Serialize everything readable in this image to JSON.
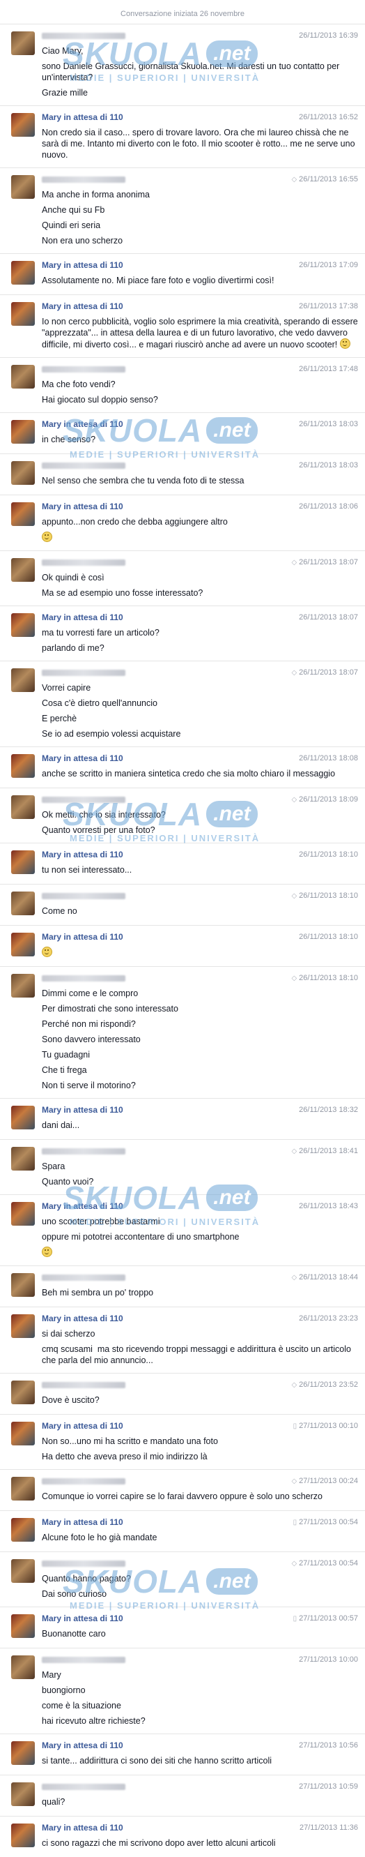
{
  "conversation": {
    "start_label": "Conversazione iniziata 26 novembre"
  },
  "watermark": {
    "logo": "SKUOLA",
    "suffix": ".net",
    "tagline": "MEDIE | SUPERIORI | UNIVERSITÀ"
  },
  "messages": [
    {
      "sender": "",
      "mary": false,
      "time": "26/11/2013 16:39",
      "icon": "",
      "lines": [
        "Ciao Mary,",
        "sono Daniele Grassucci, giornalista Skuola.net. Mi daresti un tuo contatto per un'intervista?",
        "Grazie mille"
      ]
    },
    {
      "sender": "Mary in attesa di 110",
      "mary": true,
      "time": "26/11/2013 16:52",
      "icon": "",
      "lines": [
        "Non credo sia il caso... spero di trovare lavoro. Ora che mi laureo chissà che ne sarà di me. Intanto mi diverto con le foto. Il mio scooter è rotto... me ne serve uno nuovo."
      ]
    },
    {
      "sender": "",
      "mary": false,
      "time": "26/11/2013 16:55",
      "icon": "location-icon",
      "lines": [
        "Ma anche in forma anonima",
        "Anche qui su Fb",
        "Quindi eri seria",
        "Non era uno scherzo"
      ]
    },
    {
      "sender": "Mary in attesa di 110",
      "mary": true,
      "time": "26/11/2013 17:09",
      "icon": "",
      "lines": [
        "Assolutamente no. Mi piace fare foto e voglio divertirmi così!"
      ]
    },
    {
      "sender": "Mary in attesa di 110",
      "mary": true,
      "time": "26/11/2013 17:38",
      "icon": "",
      "lines": [
        "Io non cerco pubblicità, voglio solo esprimere la mia creatività, sperando di essere \"apprezzata\"... in attesa della laurea e di un futuro lavorativo, che vedo davvero difficile, mi diverto così... e magari riuscirò anche ad avere un nuovo scooter! :)"
      ]
    },
    {
      "sender": "",
      "mary": false,
      "time": "26/11/2013 17:48",
      "icon": "",
      "lines": [
        "Ma che foto vendi?",
        "Hai giocato sul doppio senso?"
      ]
    },
    {
      "sender": "Mary in attesa di 110",
      "mary": true,
      "time": "26/11/2013 18:03",
      "icon": "",
      "lines": [
        "in che senso?"
      ]
    },
    {
      "sender": "",
      "mary": false,
      "time": "26/11/2013 18:03",
      "icon": "",
      "lines": [
        "Nel senso che sembra che tu venda foto di te stessa"
      ]
    },
    {
      "sender": "Mary in attesa di 110",
      "mary": true,
      "time": "26/11/2013 18:06",
      "icon": "",
      "lines": [
        "appunto...non credo che debba aggiungere altro",
        ":)"
      ]
    },
    {
      "sender": "",
      "mary": false,
      "time": "26/11/2013 18:07",
      "icon": "location-icon",
      "lines": [
        "Ok quindi è così",
        "Ma se ad esempio uno fosse interessato?"
      ]
    },
    {
      "sender": "Mary in attesa di 110",
      "mary": true,
      "time": "26/11/2013 18:07",
      "icon": "",
      "lines": [
        "ma tu vorresti fare un articolo?",
        "parlando di me?"
      ]
    },
    {
      "sender": "",
      "mary": false,
      "time": "26/11/2013 18:07",
      "icon": "location-icon",
      "lines": [
        "Vorrei capire",
        "Cosa c'è dietro quell'annuncio",
        "E perchè",
        "Se io ad esempio volessi acquistare"
      ]
    },
    {
      "sender": "Mary in attesa di 110",
      "mary": true,
      "time": "26/11/2013 18:08",
      "icon": "",
      "lines": [
        "anche se scritto in maniera sintetica credo che sia molto chiaro il messaggio"
      ]
    },
    {
      "sender": "",
      "mary": false,
      "time": "26/11/2013 18:09",
      "icon": "location-icon",
      "lines": [
        "Ok metti. che io sia interessato?",
        "Quanto vorresti per una foto?"
      ]
    },
    {
      "sender": "Mary in attesa di 110",
      "mary": true,
      "time": "26/11/2013 18:10",
      "icon": "",
      "lines": [
        "tu non sei interessato..."
      ]
    },
    {
      "sender": "",
      "mary": false,
      "time": "26/11/2013 18:10",
      "icon": "location-icon",
      "lines": [
        "Come no"
      ]
    },
    {
      "sender": "Mary in attesa di 110",
      "mary": true,
      "time": "26/11/2013 18:10",
      "icon": "",
      "lines": [
        ":)"
      ]
    },
    {
      "sender": "",
      "mary": false,
      "time": "26/11/2013 18:10",
      "icon": "location-icon",
      "lines": [
        "Dimmi come e le compro",
        "Per dimostrati che sono interessato",
        "Perché non mi rispondi?",
        "Sono davvero interessato",
        "Tu guadagni",
        "Che ti frega",
        "Non ti serve il motorino?"
      ]
    },
    {
      "sender": "Mary in attesa di 110",
      "mary": true,
      "time": "26/11/2013 18:32",
      "icon": "",
      "lines": [
        "dani dai..."
      ]
    },
    {
      "sender": "",
      "mary": false,
      "time": "26/11/2013 18:41",
      "icon": "location-icon",
      "lines": [
        "Spara",
        "Quanto vuoi?"
      ]
    },
    {
      "sender": "Mary in attesa di 110",
      "mary": true,
      "time": "26/11/2013 18:43",
      "icon": "",
      "lines": [
        "uno scooter potrebbe bastarmi",
        "oppure mi pototrei accontentare di uno smartphone",
        ":)"
      ]
    },
    {
      "sender": "",
      "mary": false,
      "time": "26/11/2013 18:44",
      "icon": "location-icon",
      "lines": [
        "Beh mi sembra un po' troppo"
      ]
    },
    {
      "sender": "Mary in attesa di 110",
      "mary": true,
      "time": "26/11/2013 23:23",
      "icon": "",
      "lines": [
        "si dai scherzo",
        "cmq scusami  ma sto ricevendo troppi messaggi e addirittura è uscito un articolo che parla del mio annuncio..."
      ]
    },
    {
      "sender": "",
      "mary": false,
      "time": "26/11/2013 23:52",
      "icon": "location-icon",
      "lines": [
        "Dove è uscito?"
      ]
    },
    {
      "sender": "Mary in attesa di 110",
      "mary": true,
      "time": "27/11/2013 00:10",
      "icon": "phone-icon",
      "lines": [
        "Non so...uno mi ha scritto e mandato una foto",
        "Ha detto che aveva preso il mio indirizzo là"
      ]
    },
    {
      "sender": "",
      "mary": false,
      "time": "27/11/2013 00:24",
      "icon": "location-icon",
      "lines": [
        "Comunque io vorrei capire se lo farai davvero oppure è solo uno scherzo"
      ]
    },
    {
      "sender": "Mary in attesa di 110",
      "mary": true,
      "time": "27/11/2013 00:54",
      "icon": "phone-icon",
      "lines": [
        "Alcune foto le ho già mandate"
      ]
    },
    {
      "sender": "",
      "mary": false,
      "time": "27/11/2013 00:54",
      "icon": "location-icon",
      "lines": [
        "Quanto hanno pagato?",
        "Dai sono curioso"
      ]
    },
    {
      "sender": "Mary in attesa di 110",
      "mary": true,
      "time": "27/11/2013 00:57",
      "icon": "phone-icon",
      "lines": [
        "Buonanotte caro"
      ]
    },
    {
      "sender": "",
      "mary": false,
      "time": "27/11/2013 10:00",
      "icon": "",
      "lines": [
        "Mary",
        "buongiorno",
        "come è la situazione",
        "hai ricevuto altre richieste?"
      ]
    },
    {
      "sender": "Mary in attesa di 110",
      "mary": true,
      "time": "27/11/2013 10:56",
      "icon": "",
      "lines": [
        "si tante... addirittura ci sono dei siti che hanno scritto articoli"
      ]
    },
    {
      "sender": "",
      "mary": false,
      "time": "27/11/2013 10:59",
      "icon": "",
      "lines": [
        "quali?"
      ]
    },
    {
      "sender": "Mary in attesa di 110",
      "mary": true,
      "time": "27/11/2013 11:36",
      "icon": "",
      "lines": [
        "ci sono ragazzi che mi scrivono dopo aver letto alcuni articoli"
      ]
    }
  ]
}
